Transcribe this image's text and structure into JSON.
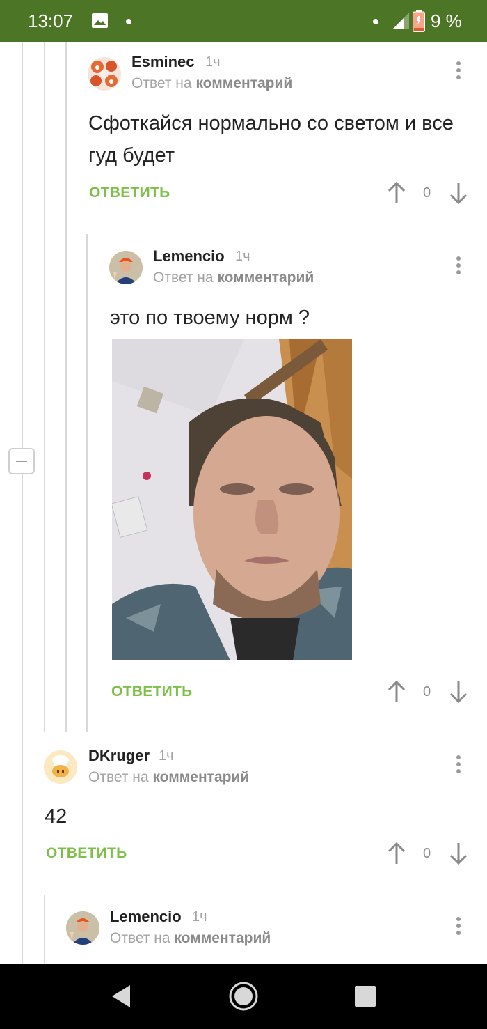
{
  "status_bar": {
    "time": "13:07",
    "battery": "9 %"
  },
  "comments": [
    {
      "author": "Esminec",
      "time": "1ч",
      "reply_prefix": "Ответ на",
      "reply_target": "комментарий",
      "text": "Сфоткайся нормально со светом и все гуд будет",
      "reply_label": "ОТВЕТИТЬ",
      "score": "0"
    },
    {
      "author": "Lemencio",
      "time": "1ч",
      "reply_prefix": "Ответ на",
      "reply_target": "комментарий",
      "text": "это по твоему норм ?",
      "reply_label": "ОТВЕТИТЬ",
      "score": "0"
    },
    {
      "author": "DKruger",
      "time": "1ч",
      "reply_prefix": "Ответ на",
      "reply_target": "комментарий",
      "text": "42",
      "reply_label": "ОТВЕТИТЬ",
      "score": "0"
    },
    {
      "author": "Lemencio",
      "time": "1ч",
      "reply_prefix": "Ответ на",
      "reply_target": "комментарий"
    }
  ],
  "colors": {
    "status_bar": "#4d7526",
    "reply_button": "#7cc048",
    "muted_text": "#a3a3a3"
  }
}
